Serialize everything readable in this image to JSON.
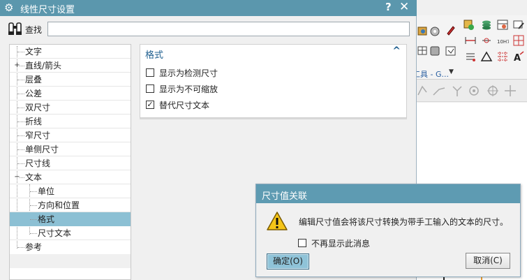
{
  "dialog": {
    "title": "线性尺寸设置",
    "help_label": "?",
    "close_label": "✕"
  },
  "find": {
    "label": "查找",
    "value": ""
  },
  "tree": {
    "items": [
      {
        "label": "文字",
        "level": 1
      },
      {
        "label": "直线/箭头",
        "level": 1,
        "expander": "+"
      },
      {
        "label": "层叠",
        "level": 1
      },
      {
        "label": "公差",
        "level": 1
      },
      {
        "label": "双尺寸",
        "level": 1
      },
      {
        "label": "折线",
        "level": 1
      },
      {
        "label": "窄尺寸",
        "level": 1
      },
      {
        "label": "单侧尺寸",
        "level": 1
      },
      {
        "label": "尺寸线",
        "level": 1
      },
      {
        "label": "文本",
        "level": 1,
        "expander": "−"
      },
      {
        "label": "单位",
        "level": 2
      },
      {
        "label": "方向和位置",
        "level": 2
      },
      {
        "label": "格式",
        "level": 2,
        "selected": true
      },
      {
        "label": "尺寸文本",
        "level": 2
      },
      {
        "label": "参考",
        "level": 1
      }
    ]
  },
  "format_panel": {
    "title": "格式",
    "checkboxes": [
      {
        "label": "显示为检测尺寸",
        "checked": false
      },
      {
        "label": "显示为不可缩放",
        "checked": false
      },
      {
        "label": "替代尺寸文本",
        "checked": true
      }
    ]
  },
  "association_dialog": {
    "title": "尺寸值关联",
    "message": "编辑尺寸值会将该尺寸转换为带手工输入的文本的尺寸。",
    "dont_show_label": "不再显示此消息",
    "dont_show_checked": false,
    "ok_label": "确定(O)",
    "cancel_label": "取消(C)"
  },
  "background_app": {
    "tools_label": "工具 - G...",
    "icons": [
      "new-view-icon",
      "layers-icon",
      "table-icon",
      "edit-icon",
      "dimension-icon",
      "grid-icon",
      "text-icon",
      "symbol-icon",
      "triangle-icon",
      "a-arrow-icon"
    ]
  },
  "colors": {
    "title_bar": "#5b97ad",
    "selection": "#8cc0d4",
    "accent_text": "#1f5f8f"
  }
}
